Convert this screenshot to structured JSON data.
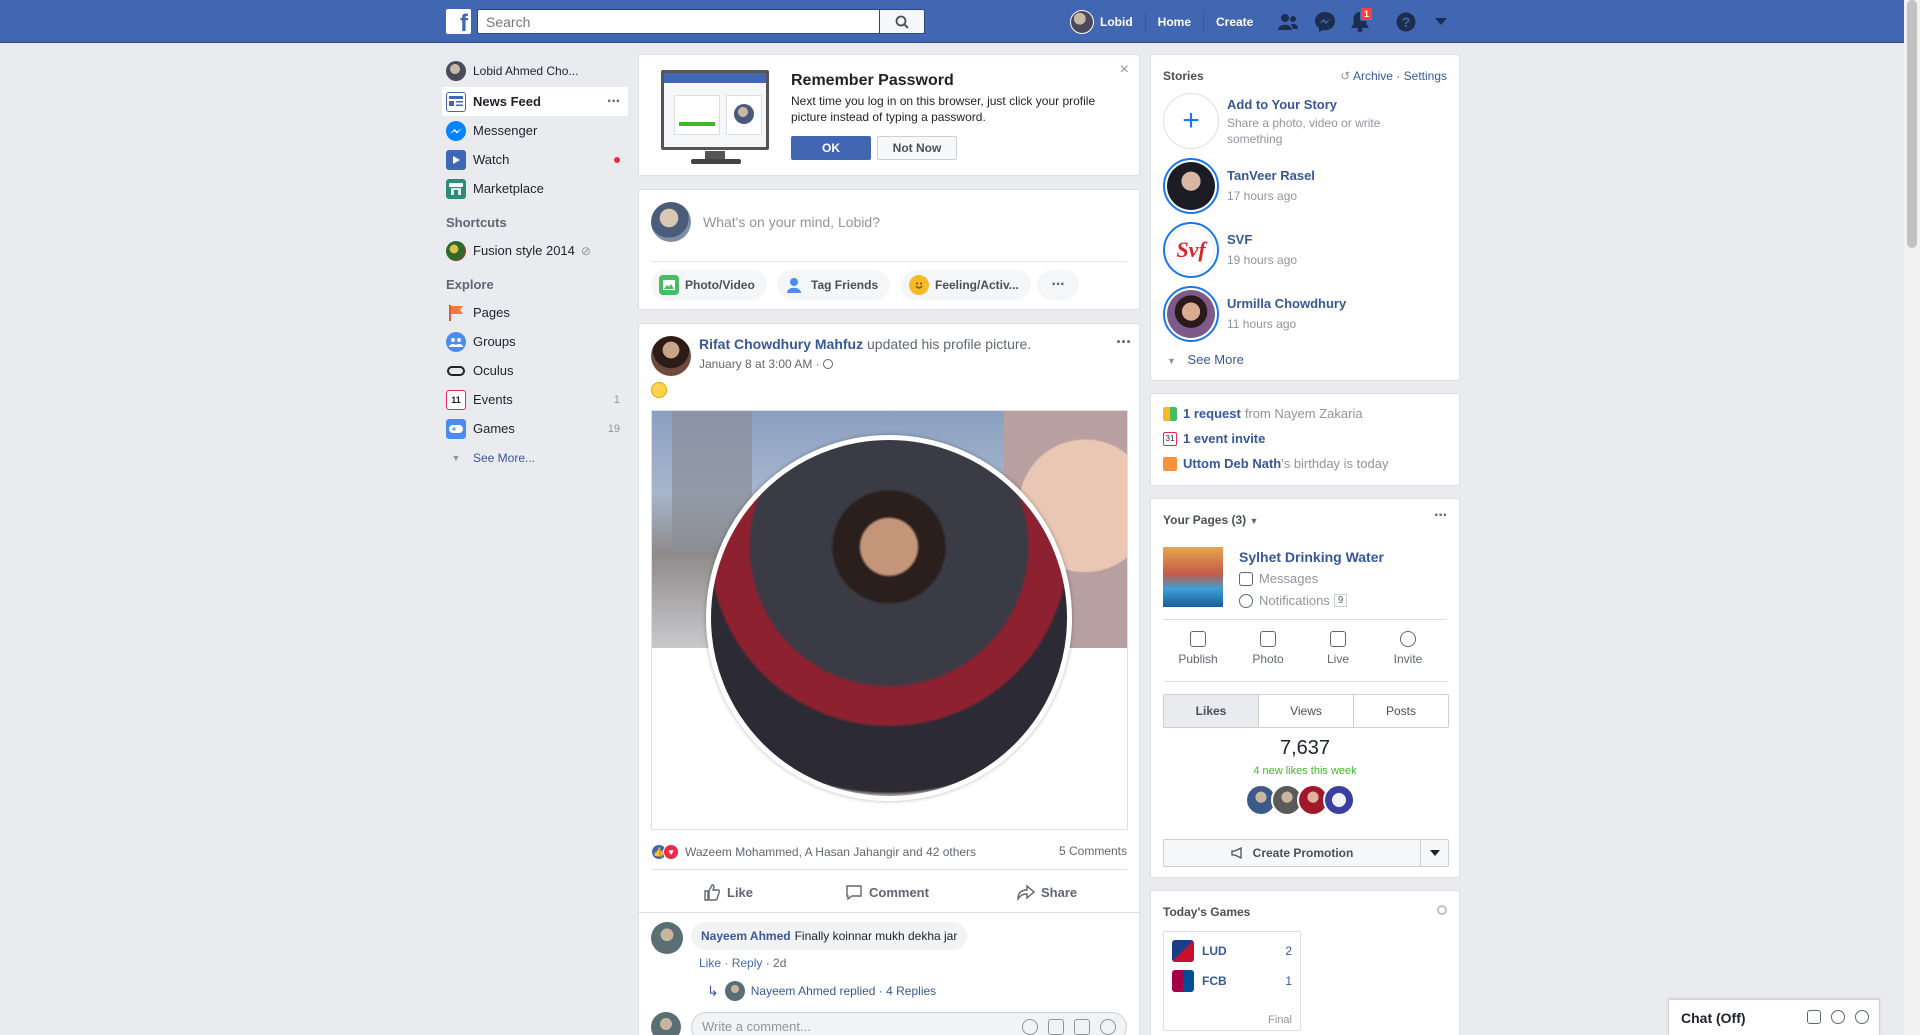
{
  "topbar": {
    "logo": "f",
    "search_placeholder": "Search",
    "user_name": "Lobid",
    "home": "Home",
    "create": "Create",
    "notification_count": "1",
    "bar_color": "#4267b2"
  },
  "leftnav": {
    "profile_name": "Lobid Ahmed Cho...",
    "items": [
      {
        "label": "News Feed",
        "icon": "news-feed-icon"
      },
      {
        "label": "Messenger",
        "icon": "messenger-icon"
      },
      {
        "label": "Watch",
        "icon": "watch-icon"
      },
      {
        "label": "Marketplace",
        "icon": "marketplace-icon"
      }
    ],
    "shortcuts_heading": "Shortcuts",
    "shortcut": "Fusion style 2014",
    "explore_heading": "Explore",
    "explore": [
      {
        "label": "Pages",
        "count": ""
      },
      {
        "label": "Groups",
        "count": ""
      },
      {
        "label": "Oculus",
        "count": ""
      },
      {
        "label": "Events",
        "count": "1"
      },
      {
        "label": "Games",
        "count": "19"
      }
    ],
    "see_more": "See More..."
  },
  "remember": {
    "title": "Remember Password",
    "text": "Next time you log in on this browser, just click your profile picture instead of typing a password.",
    "ok": "OK",
    "not_now": "Not Now"
  },
  "composer": {
    "placeholder": "What's on your mind, Lobid?",
    "photo_video": "Photo/Video",
    "tag_friends": "Tag Friends",
    "feeling": "Feeling/Activ..."
  },
  "post": {
    "author": "Rifat Chowdhury Mahfuz",
    "action": "updated his profile picture.",
    "time": "January 8 at 3:00 AM · ",
    "reactions_text": "Wazeem Mohammed, A Hasan Jahangir and 42 others",
    "comments_count": "5 Comments",
    "like": "Like",
    "comment": "Comment",
    "share": "Share",
    "comment_author": "Nayeem Ahmed",
    "comment_text": "Finally koinnar mukh dekha jar",
    "comment_like": "Like",
    "comment_reply": "Reply",
    "comment_age": "2d",
    "replies_text": "Nayeem Ahmed replied · 4 Replies",
    "write_placeholder": "Write a comment..."
  },
  "stories": {
    "title": "Stories",
    "archive": "Archive",
    "settings": "Settings",
    "add_title": "Add to Your Story",
    "add_sub": "Share a photo, video or write something",
    "items": [
      {
        "name": "TanVeer Rasel",
        "time": "17 hours ago"
      },
      {
        "name": "SVF",
        "time": "19 hours ago"
      },
      {
        "name": "Urmilla Chowdhury",
        "time": "11 hours ago"
      }
    ],
    "see_more": "See More"
  },
  "requests": {
    "request_bold": "1 request",
    "request_rest": "from Nayem Zakaria",
    "event_bold": "1 event invite",
    "birthday_bold": "Uttom Deb Nath",
    "birthday_rest": "'s birthday is today"
  },
  "pages": {
    "title": "Your Pages (3)",
    "page_name": "Sylhet Drinking Water",
    "messages": "Messages",
    "notifications": "Notifications",
    "notifications_count": "9",
    "actions": [
      "Publish",
      "Photo",
      "Live",
      "Invite"
    ],
    "tabs": [
      "Likes",
      "Views",
      "Posts"
    ],
    "likes_total": "7,637",
    "new_likes": "4 new likes this week",
    "create_promotion": "Create Promotion"
  },
  "games": {
    "title": "Today's Games",
    "teams": [
      {
        "name": "LUD",
        "score": "2"
      },
      {
        "name": "FCB",
        "score": "1"
      }
    ],
    "status": "Final"
  },
  "chat": {
    "label": "Chat (Off)"
  }
}
